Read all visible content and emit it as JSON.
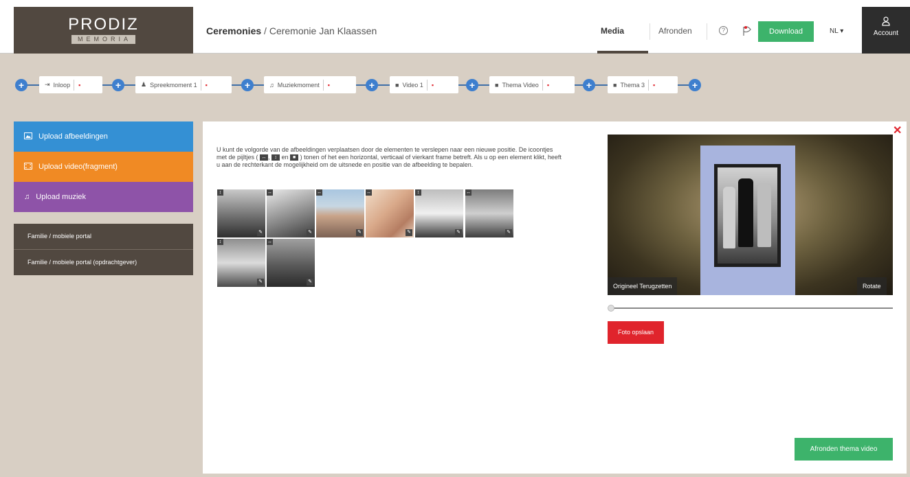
{
  "header": {
    "logo_brand": "PRODIZ",
    "logo_sub": "MEMORIA",
    "breadcrumb_root": "Ceremonies",
    "breadcrumb_sep": "/",
    "breadcrumb_current": "Ceremonie Jan Klaassen",
    "nav_media": "Media",
    "nav_afronden": "Afronden",
    "help_icon": "?",
    "download_label": "Download",
    "lang_label": "NL ▾",
    "account_icon": "person-icon",
    "account_label": "Account"
  },
  "timeline": {
    "items": [
      {
        "label": "Inloop",
        "icon": "enter-icon",
        "glyph": "⇥"
      },
      {
        "label": "Spreekmoment 1",
        "icon": "person-icon",
        "glyph": "♟"
      },
      {
        "label": "Muziekmoment",
        "icon": "music-icon",
        "glyph": "♫"
      },
      {
        "label": "Video 1",
        "icon": "video-icon",
        "glyph": "■"
      },
      {
        "label": "Thema Video",
        "icon": "video-icon",
        "glyph": "■"
      },
      {
        "label": "Thema 3",
        "icon": "video-icon",
        "glyph": "■"
      }
    ],
    "plus_label": "+",
    "trash_glyph": "▪"
  },
  "sidebar": {
    "upload_images": "Upload afbeeldingen",
    "upload_video": "Upload video(fragment)",
    "upload_music": "Upload muziek",
    "portal_1": "Familie / mobiele portal",
    "portal_2": "Familie / mobiele portal (opdrachtgever)"
  },
  "main": {
    "instructions_1": "U kunt de volgorde van de afbeeldingen verplaatsen door de elementen te verslepen naar een nieuwe positie. De icoontjes met de pijltjes (",
    "instructions_and": "en",
    "instructions_2": ") tonen of het een horizontal, verticaal of vierkant frame betreft. Als u op een element klikt, heeft u aan de rechterkant de mogelijkheid om de uitsnede en positie van de afbeelding te bepalen.",
    "icon_horizontal": "↔",
    "icon_vertical": "↕",
    "icon_square": "■",
    "close_glyph": "✕",
    "thumbnails": [
      {
        "orientation": "↕"
      },
      {
        "orientation": "↔"
      },
      {
        "orientation": "↔"
      },
      {
        "orientation": "↔"
      },
      {
        "orientation": "↕"
      },
      {
        "orientation": "↔"
      },
      {
        "orientation": "↕"
      },
      {
        "orientation": "↔"
      }
    ],
    "edit_glyph": "✎",
    "preview_reset": "Origineel Terugzetten",
    "preview_rotate": "Rotate",
    "save_photo": "Foto opslaan",
    "finish_label": "Afronden thema video",
    "slider_value": 0
  },
  "colors": {
    "brand_dark": "#514840",
    "blue": "#3490d4",
    "orange": "#f08a24",
    "purple": "#8e53a8",
    "green": "#3db36b",
    "red": "#e0242c"
  }
}
